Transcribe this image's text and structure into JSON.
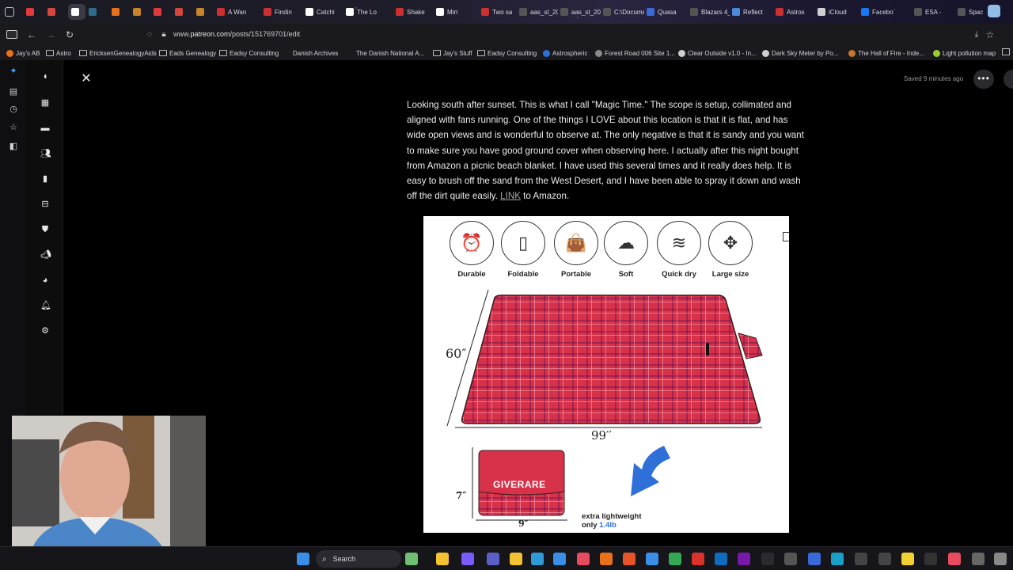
{
  "browser": {
    "tabs": [
      {
        "label": "",
        "color": "#e33b3b"
      },
      {
        "label": "",
        "color": "#d6453d"
      },
      {
        "label": "",
        "color": "#ffffff",
        "active": true
      },
      {
        "label": "",
        "color": "#2d6a8c"
      },
      {
        "label": "",
        "color": "#e8711a"
      },
      {
        "label": "",
        "color": "#c7842b"
      },
      {
        "label": "",
        "color": "#e03a3a"
      },
      {
        "label": "",
        "color": "#d6453d"
      },
      {
        "label": "",
        "color": "#c7842b"
      },
      {
        "label": "A Wan",
        "color": "#cc3030"
      },
      {
        "label": "Findin",
        "color": "#cc3030"
      },
      {
        "label": "Catchi",
        "color": "#ffffff"
      },
      {
        "label": "The Lo",
        "color": "#ffffff"
      },
      {
        "label": "Shake",
        "color": "#cc3030"
      },
      {
        "label": "Mirr",
        "color": "#ffffff"
      },
      {
        "label": "Two sa",
        "color": "#cc3030"
      },
      {
        "label": "aas_st_202",
        "color": ""
      },
      {
        "label": "aas_st_202",
        "color": ""
      },
      {
        "label": "C:\\Docume",
        "color": ""
      },
      {
        "label": "Quasa",
        "color": "#3a6ad8"
      },
      {
        "label": "Blazars 4_",
        "color": ""
      },
      {
        "label": "Reflect",
        "color": "#4a8ad8"
      },
      {
        "label": "Astros",
        "color": "#cc3030"
      },
      {
        "label": "iCloud",
        "color": "#cfcfcf"
      },
      {
        "label": "Facebo",
        "color": "#1877f2"
      },
      {
        "label": "ESA -",
        "color": ""
      },
      {
        "label": "Space",
        "color": ""
      }
    ],
    "url_prefix": "www.",
    "url_domain": "patreon.com",
    "url_path": "/posts/151769701/edit"
  },
  "bookmarks": [
    {
      "label": "Jay's AB",
      "kind": "site",
      "color": "#e8711a"
    },
    {
      "label": "Astro",
      "kind": "folder"
    },
    {
      "label": "EricksenGenealogyAids",
      "kind": "folder"
    },
    {
      "label": "Eads Genealogy",
      "kind": "folder"
    },
    {
      "label": "Eadsy Consulting",
      "kind": "folder"
    },
    {
      "label": "Danish Archives",
      "kind": "site",
      "color": ""
    },
    {
      "label": "The Danish National A...",
      "kind": "site",
      "color": ""
    },
    {
      "label": "Jay's Stuff",
      "kind": "folder"
    },
    {
      "label": "Eadsy Consulting",
      "kind": "folder"
    },
    {
      "label": "Astrospheric",
      "kind": "site",
      "color": "#2f6fd8"
    },
    {
      "label": "Forest Road 006 Site 1...",
      "kind": "site",
      "color": "#8a8a8a"
    },
    {
      "label": "Clear Outside v1.0 - In...",
      "kind": "site",
      "color": "#cfcfcf"
    },
    {
      "label": "Dark Sky Meter by Po...",
      "kind": "site",
      "color": "#cfcfcf"
    },
    {
      "label": "The Hall of Fire - Inde...",
      "kind": "site",
      "color": "#c47a2a"
    },
    {
      "label": "Light pollution map",
      "kind": "site",
      "color": "#9acd32"
    }
  ],
  "editor": {
    "saved_status": "Saved 9 minutes ago",
    "more_label": "•••",
    "paragraph_part1": "Looking south after sunset.  This is what I call \"Magic Time.\"  The scope is setup, collimated and aligned with fans running. One of the things I LOVE about this location is that it is flat, and has wide open views and is wonderful to observe at. The only negative is that it is sandy and you want to make sure you have good ground cover when observing here. I actually after this night bought from Amazon a picnic beach blanket. I have used this several times and it really does help. It is easy to brush off the sand from the West Desert, and I have been able to spray it down and wash off the dirt quite easily.  ",
    "link_text": "LINK",
    "paragraph_part2": " to Amazon."
  },
  "product_image": {
    "features": [
      {
        "label": "Durable",
        "icon": "alarm-clock-icon",
        "glyph": "⏰"
      },
      {
        "label": "Foldable",
        "icon": "fold-icon",
        "glyph": "▯"
      },
      {
        "label": "Portable",
        "icon": "hand-bag-icon",
        "glyph": "👜"
      },
      {
        "label": "Soft",
        "icon": "cloud-icon",
        "glyph": "☁"
      },
      {
        "label": "Quick dry",
        "icon": "heat-waves-icon",
        "glyph": "≋"
      },
      {
        "label": "Large size",
        "icon": "expand-arrows-icon",
        "glyph": "✥"
      }
    ],
    "dim_height": "60″",
    "dim_width": "99′′",
    "folded_height": "7″",
    "folded_width": "9″",
    "brand": "GIVERARE",
    "note_line1": "extra lightweight",
    "note_line2_prefix": "only ",
    "note_weight": "1.4lb",
    "blanket_color": "#d8324a",
    "accent_blue": "#2f6fd8"
  },
  "taskbar": {
    "search_label": "Search"
  }
}
